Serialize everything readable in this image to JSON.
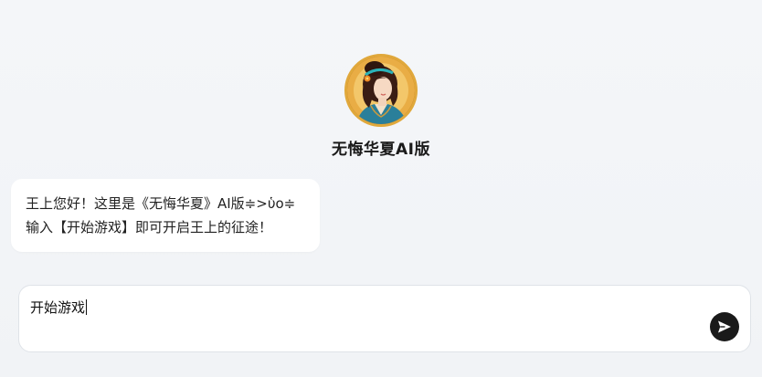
{
  "header": {
    "avatar_icon": "character-portrait-icon",
    "title": "无悔华夏AI版"
  },
  "chat": {
    "messages": [
      {
        "role": "assistant",
        "lines": [
          "王上您好！这里是《无悔华夏》AI版≑>ὑo≑",
          "输入【开始游戏】即可开启王上的征途！"
        ]
      }
    ]
  },
  "composer": {
    "value": "开始游戏",
    "send_icon": "send-arrow-icon"
  },
  "colors": {
    "send_button": "#1a1a1a",
    "avatar_ring": "#e0a83b",
    "bubble_bg": "#ffffff",
    "page_bg": "#f3f5f8"
  }
}
